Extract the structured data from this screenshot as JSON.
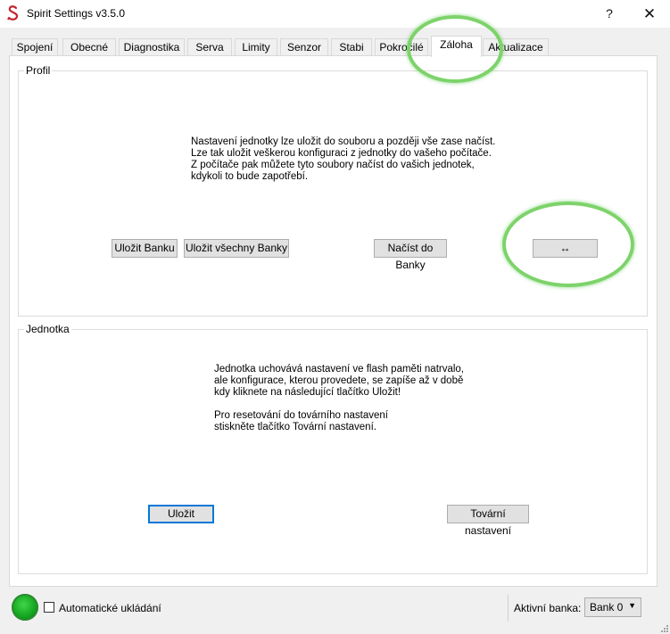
{
  "window": {
    "title": "Spirit Settings v3.5.0",
    "help": "?",
    "close": "✕"
  },
  "tabs": [
    "Spojení",
    "Obecné",
    "Diagnostika",
    "Serva",
    "Limity",
    "Senzor",
    "Stabi",
    "Pokročilé",
    "Záloha",
    "Aktualizace"
  ],
  "active_tab": "Záloha",
  "profile": {
    "title": "Profil",
    "text": "Nastavení jednotky lze uložit do souboru a později vše zase načíst.\nLze tak uložit veškerou konfiguraci z jednotky do vašeho počítače.\nZ počítače pak můžete tyto soubory načíst do vašich jednotek,\nkdykoli to bude zapotřebí.",
    "save_bank": "Uložit Banku",
    "save_all": "Uložit všechny Banky",
    "load_bank": "Načíst do Banky",
    "swap": "↔"
  },
  "unit": {
    "title": "Jednotka",
    "text": "Jednotka uchovává nastavení ve flash paměti natrvalo,\nale konfigurace, kterou provedete, se zapíše až v době\nkdy kliknete na následující tlačítko Uložit!\n\nPro resetování do továrního nastavení\nstiskněte tlačítko Tovární nastavení.",
    "save": "Uložit",
    "factory": "Tovární nastavení"
  },
  "status": {
    "auto_save": "Automatické ukládání",
    "active_bank_label": "Aktivní banka:",
    "active_bank_value": "Bank 0"
  },
  "colors": {
    "highlight": "#7dd36a",
    "led": "#22b52c",
    "default_button_border": "#0078d7"
  }
}
